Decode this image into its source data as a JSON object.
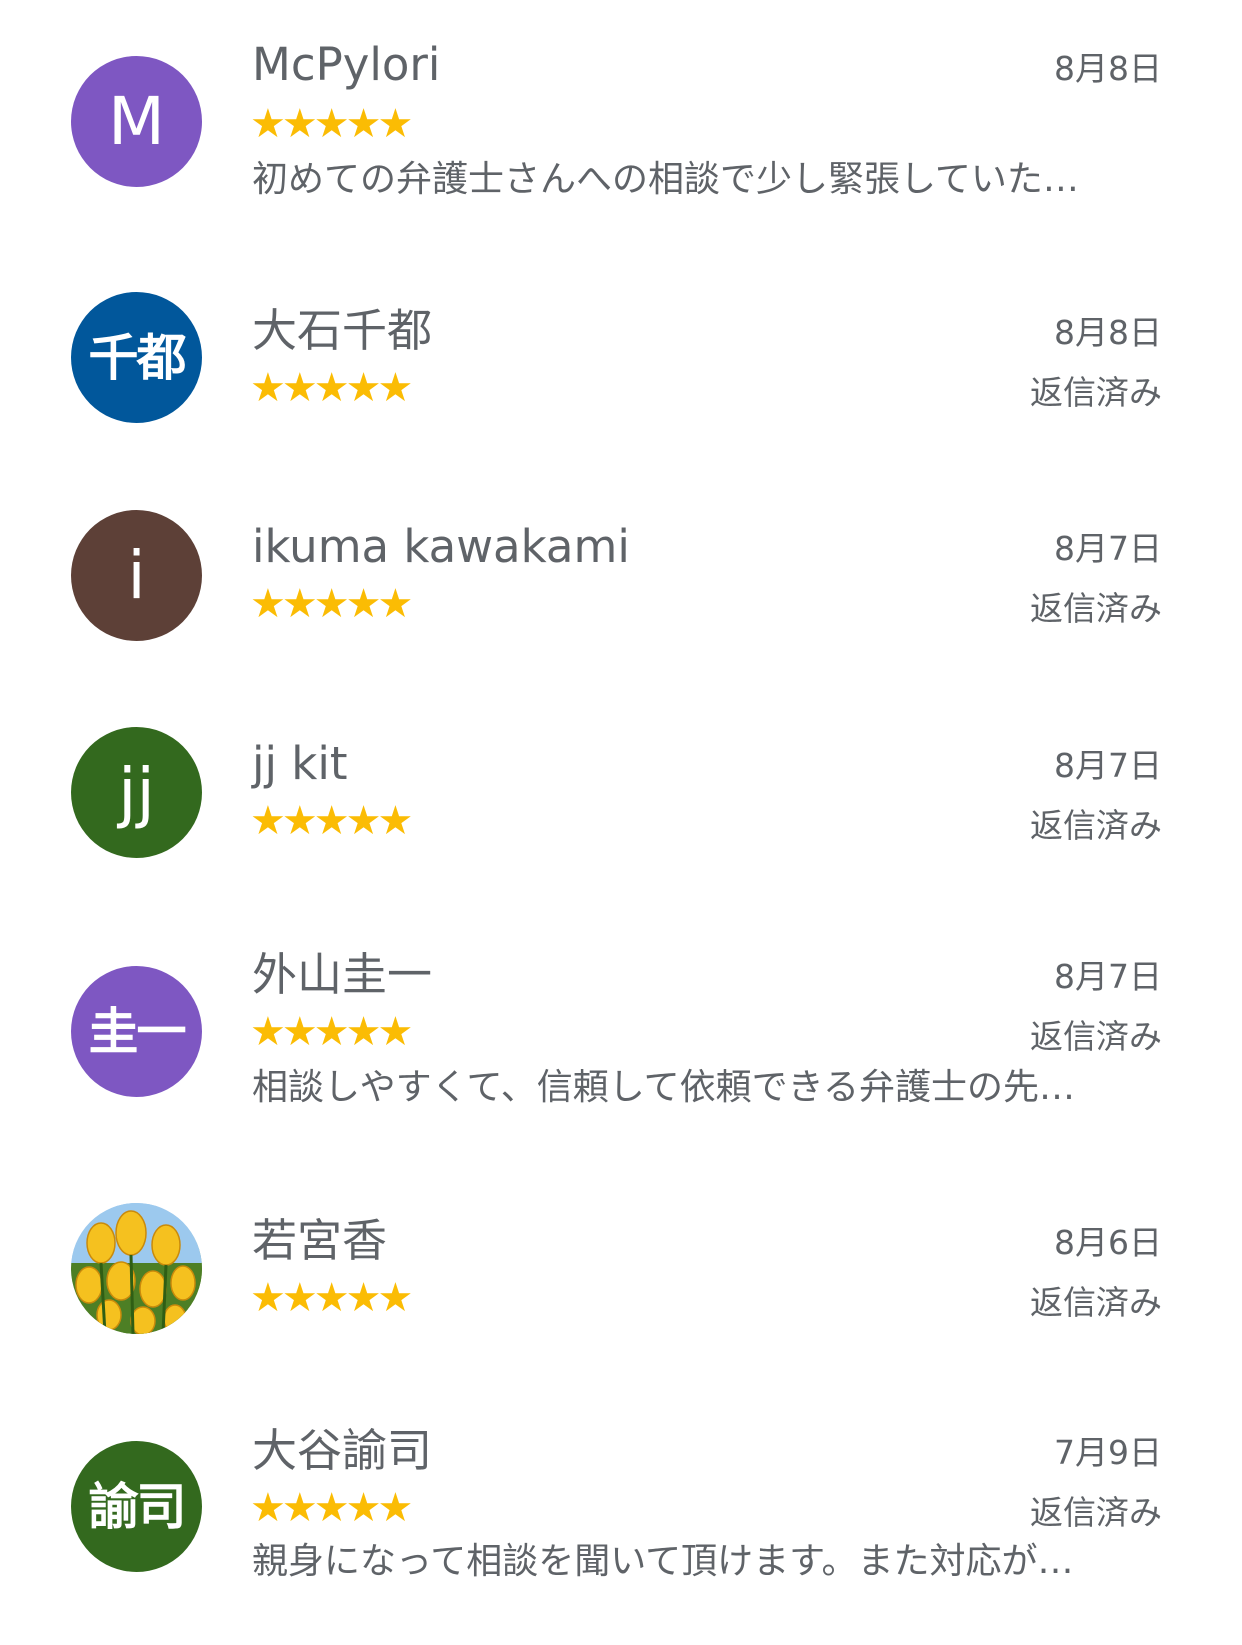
{
  "reviews": [
    {
      "name": "McPylori",
      "avatar_text": "M",
      "avatar_color": "#7e57c2",
      "stars": "★★★★★",
      "date": "8月8日",
      "replied": "",
      "snippet": "初めての弁護士さんへの相談で少し緊張していた…"
    },
    {
      "name": "大石千都",
      "avatar_text": "千都",
      "avatar_color": "#01579b",
      "stars": "★★★★★",
      "date": "8月8日",
      "replied": "返信済み",
      "snippet": ""
    },
    {
      "name": "ikuma kawakami",
      "avatar_text": "i",
      "avatar_color": "#5d4037",
      "stars": "★★★★★",
      "date": "8月7日",
      "replied": "返信済み",
      "snippet": ""
    },
    {
      "name": "jj kit",
      "avatar_text": "jj",
      "avatar_color": "#33691e",
      "stars": "★★★★★",
      "date": "8月7日",
      "replied": "返信済み",
      "snippet": ""
    },
    {
      "name": "外山圭一",
      "avatar_text": "圭一",
      "avatar_color": "#7e57c2",
      "stars": "★★★★★",
      "date": "8月7日",
      "replied": "返信済み",
      "snippet": "相談しやすくて、信頼して依頼できる弁護士の先…"
    },
    {
      "name": "若宮香",
      "avatar_text": "",
      "avatar_color": "",
      "stars": "★★★★★",
      "date": "8月6日",
      "replied": "返信済み",
      "snippet": ""
    },
    {
      "name": "大谷諭司",
      "avatar_text": "諭司",
      "avatar_color": "#33691e",
      "stars": "★★★★★",
      "date": "7月9日",
      "replied": "返信済み",
      "snippet": "親身になって相談を聞いて頂けます。また対応が…"
    }
  ]
}
